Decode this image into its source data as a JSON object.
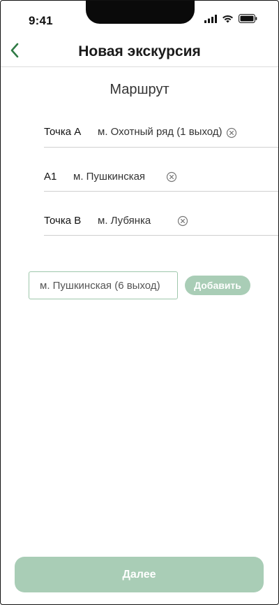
{
  "status_bar": {
    "time": "9:41",
    "icons": [
      "cellular-signal-icon",
      "wifi-icon",
      "battery-icon"
    ]
  },
  "header": {
    "back_icon": "chevron-left-icon",
    "title": "Новая экскурсия"
  },
  "route": {
    "title": "Маршрут",
    "points": [
      {
        "label": "Точка А",
        "value": "м. Охотный ряд (1 выход)",
        "clear_icon": "clear-circle-x-icon"
      },
      {
        "label": "А1",
        "value": "м. Пушкинская",
        "clear_icon": "clear-circle-x-icon"
      },
      {
        "label": "Точка B",
        "value": "м. Лубянка",
        "clear_icon": "clear-circle-x-icon"
      }
    ]
  },
  "add_point": {
    "input_value": "м. Пушкинская (6 выход)",
    "button_label": "Добавить"
  },
  "footer": {
    "next_label": "Далее"
  },
  "colors": {
    "accent": "#2f7a45",
    "button_disabled": "#a9cdb6",
    "input_border": "#9ec7ab",
    "divider": "#cfcfcf"
  }
}
